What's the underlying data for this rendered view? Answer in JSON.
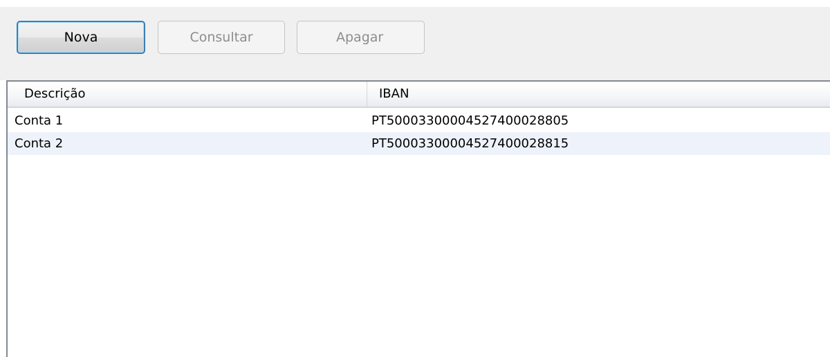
{
  "toolbar": {
    "new_label": "Nova",
    "view_label": "Consultar",
    "delete_label": "Apagar"
  },
  "table": {
    "columns": [
      "Descrição",
      "IBAN"
    ],
    "rows": [
      {
        "descricao": "Conta 1",
        "iban": "PT50003300004527400028805"
      },
      {
        "descricao": "Conta 2",
        "iban": "PT50003300004527400028815"
      }
    ]
  },
  "colors": {
    "toolbar_background": "#f0f0f0",
    "primary_button_border": "#3c7fb1",
    "disabled_text": "#8d8d8d",
    "alternate_row": "#eef2fb",
    "grid_border": "#828790"
  }
}
